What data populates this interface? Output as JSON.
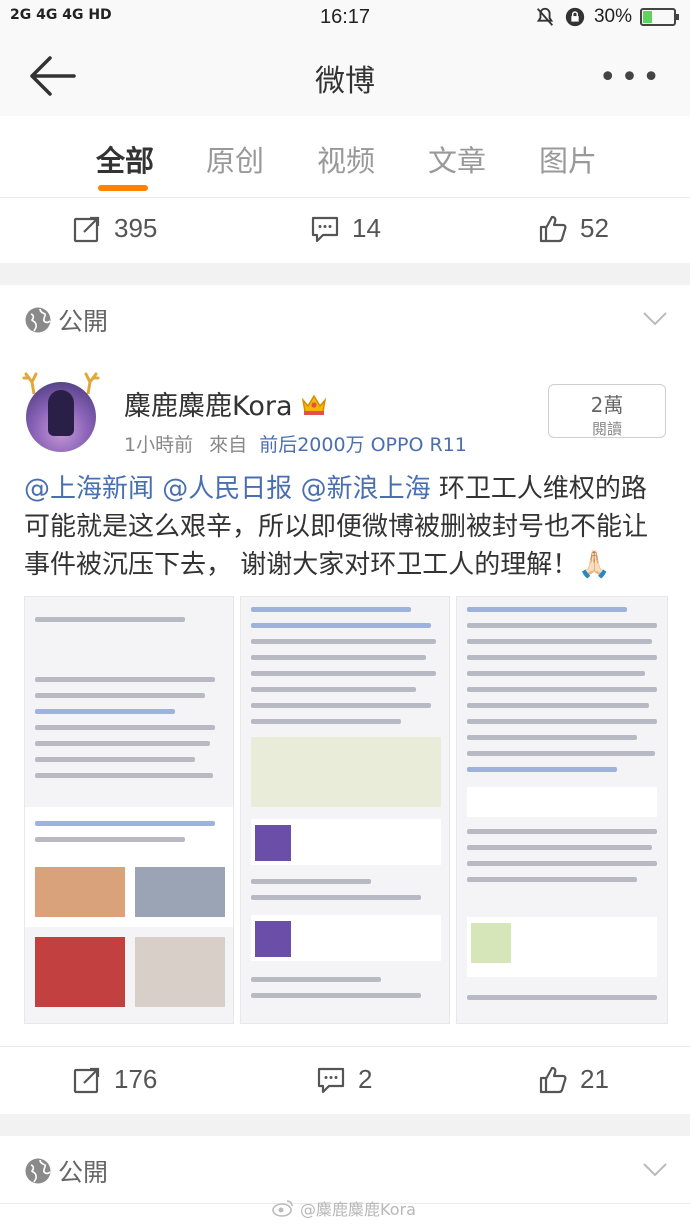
{
  "status_bar": {
    "network": "2G 4G 4G HD",
    "time": "16:17",
    "battery": "30%",
    "battery_level": 0.3
  },
  "nav": {
    "title": "微博"
  },
  "tabs": [
    {
      "label": "全部",
      "active": true
    },
    {
      "label": "原创",
      "active": false
    },
    {
      "label": "视频",
      "active": false
    },
    {
      "label": "文章",
      "active": false
    },
    {
      "label": "图片",
      "active": false
    }
  ],
  "prev_post_actions": {
    "repost": "395",
    "comment": "14",
    "like": "52"
  },
  "visibility_label": "公開",
  "post": {
    "username": "麋鹿麋鹿Kora",
    "time": "1小時前",
    "from_prefix": "來自",
    "source": "前后2000万 OPPO R11",
    "reads_count": "2萬",
    "reads_label": "閱讀",
    "mentions": [
      "@上海新闻",
      "@人民日报",
      "@新浪上海"
    ],
    "text": "环卫工人维权的路可能就是这么艰辛，所以即便微博被删被封号也不能让事件被沉压下去， 谢谢大家对环卫工人的理解！🙏🏻",
    "actions": {
      "repost": "176",
      "comment": "2",
      "like": "21"
    }
  },
  "next_visibility_label": "公開",
  "watermark": "@麋鹿麋鹿Kora",
  "colors": {
    "accent": "#ff8200",
    "link": "#4a6fb0",
    "background": "#f2f2f2"
  }
}
